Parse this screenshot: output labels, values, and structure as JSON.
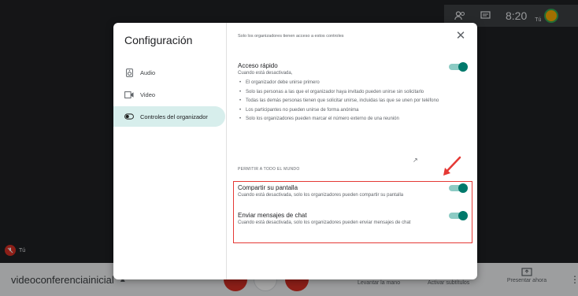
{
  "topbar": {
    "people_icon": "people-icon",
    "chat_icon": "chat-icon",
    "time": "8:20",
    "you_label": "Tú"
  },
  "self_tile": {
    "name": "Tú"
  },
  "bottombar": {
    "meeting_name": "videoconferenciainicial",
    "raise_hand": "Levantar la mano",
    "captions": "Activar subtítulos",
    "present": "Presentar ahora"
  },
  "dialog": {
    "title": "Configuración",
    "notice": "Solo los organizadores tienen acceso a estos controles",
    "nav": [
      {
        "label": "Audio",
        "icon": "speaker-icon"
      },
      {
        "label": "Video",
        "icon": "video-icon"
      },
      {
        "label": "Controles del organizador",
        "icon": "toggle-icon",
        "active": true
      }
    ],
    "quick_access": {
      "title": "Acceso rápido",
      "desc": "Cuando está desactivada,",
      "enabled": true,
      "bullets": [
        "El organizador debe unirse primero",
        "Solo las personas a las que el organizador haya invitado pueden unirse sin solicitarlo",
        "Todas las demás personas tienen que solicitar unirse, incluidas las que se unen por teléfono",
        "Los participantes no pueden unirse de forma anónima",
        "Solo los organizadores pueden marcar el número externo de una reunión"
      ]
    },
    "allow_all_heading": "PERMITIR A TODO EL MUNDO",
    "share_screen": {
      "title": "Compartir su pantalla",
      "desc": "Cuando está desactivada, solo los organizadores pueden compartir su pantalla",
      "enabled": true
    },
    "send_chat": {
      "title": "Enviar mensajes de chat",
      "desc": "Cuando está desactivada, solo los organizadores pueden enviar mensajes de chat",
      "enabled": true
    }
  },
  "colors": {
    "accent": "#00796b",
    "highlight": "#e53935",
    "end_call": "#d93025"
  }
}
